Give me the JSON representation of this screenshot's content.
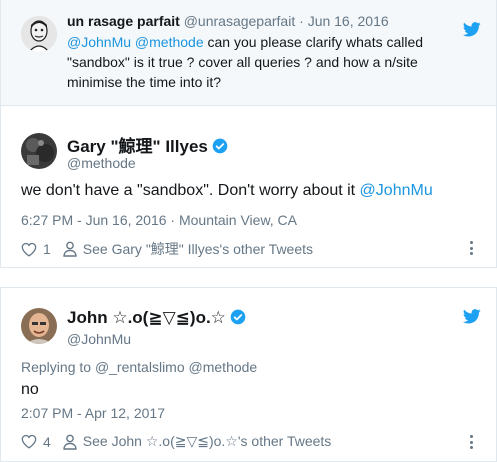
{
  "parent_tweet": {
    "author_name": "un rasage parfait",
    "author_handle": "@unrasageparfait",
    "separator": "·",
    "date": "Jun 16, 2016",
    "mentions": "@JohnMu @methode",
    "text": " can you please clarify whats called \"sandbox\" is it true ? cover all queries ? and how a n/site minimise the time into it?"
  },
  "reply_gary": {
    "display_name": "Gary \"鯨理\" Illyes",
    "handle": "@methode",
    "text_before": "we don't have a \"sandbox\". Don't worry about it ",
    "text_mention": "@JohnMu",
    "timestamp": "6:27 PM - Jun 16, 2016 · Mountain View, CA",
    "like_count": "1",
    "other_tweets_link": "See Gary \"鯨理\" Illyes's other Tweets"
  },
  "reply_john": {
    "display_name": "John ☆.o(≧▽≦)o.☆",
    "handle": "@JohnMu",
    "replying_prefix": "Replying to ",
    "replying_to": "@_rentalslimo @methode",
    "text": "no",
    "timestamp": "2:07 PM - Apr 12, 2017",
    "like_count": "4",
    "other_tweets_link": "See John ☆.o(≧▽≦)o.☆'s other Tweets"
  },
  "colors": {
    "twitter_blue": "#1da1f2",
    "link_blue": "#1b95e0",
    "muted_gray": "#657786",
    "border": "#e1e8ed",
    "parent_bg": "#f5f8fa"
  },
  "icons": [
    "twitter-bird-icon",
    "verified-badge-icon",
    "heart-icon",
    "person-icon",
    "more-options-icon"
  ]
}
